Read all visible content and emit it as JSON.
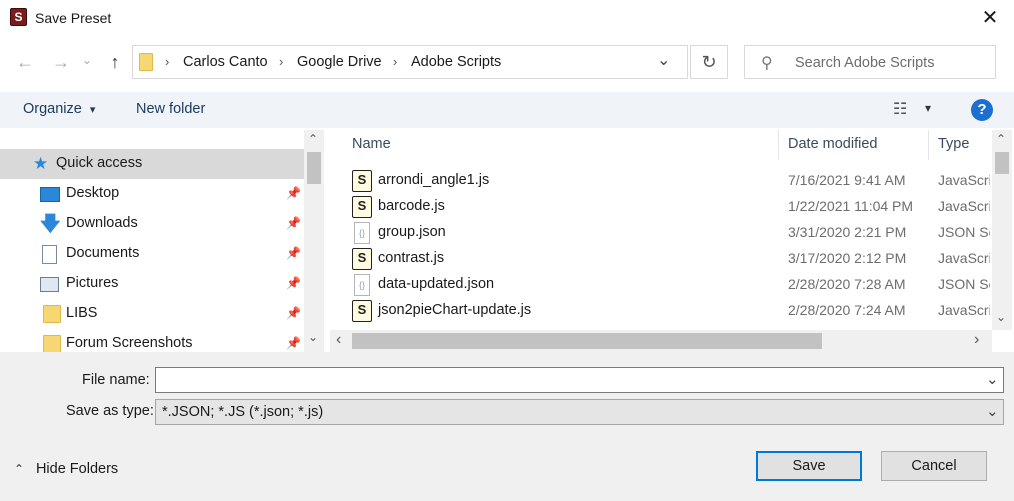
{
  "window": {
    "title": "Save Preset",
    "app_icon": "S",
    "close_glyph": "✕"
  },
  "address": {
    "back_glyph": "←",
    "forward_glyph": "→",
    "recent_glyph": "⌄",
    "up_glyph": "↑",
    "crumbs": [
      "Carlos Canto",
      "Google Drive",
      "Adobe Scripts"
    ],
    "separator": "›",
    "dropdown_glyph": "⌄",
    "refresh_glyph": "↻",
    "search_icon_glyph": "⚲",
    "search_placeholder": "Search Adobe Scripts"
  },
  "toolbar": {
    "organize": "Organize",
    "organize_caret": "▾",
    "new_folder": "New folder",
    "view_glyph": "☷",
    "view_caret": "▾",
    "help": "?"
  },
  "nav": {
    "items": [
      {
        "label": "Quick access",
        "icon": "star-icon"
      },
      {
        "label": "Desktop",
        "icon": "desktop-icon"
      },
      {
        "label": "Downloads",
        "icon": "download-arrow-icon"
      },
      {
        "label": "Documents",
        "icon": "document-icon"
      },
      {
        "label": "Pictures",
        "icon": "picture-icon"
      },
      {
        "label": "LIBS",
        "icon": "folder-icon"
      },
      {
        "label": "Forum Screenshots",
        "icon": "folder-icon"
      }
    ],
    "pin_glyph": "📌",
    "scroll_up": "⌃",
    "scroll_down": "⌄"
  },
  "files": {
    "columns": {
      "name": "Name",
      "date": "Date modified",
      "type": "Type"
    },
    "sort_glyph": "⌃",
    "rows": [
      {
        "name": "arrondi_angle1.js",
        "date": "7/16/2021 9:41 AM",
        "type": "JavaScri",
        "icon": "js-script-icon"
      },
      {
        "name": "barcode.js",
        "date": "1/22/2021 11:04 PM",
        "type": "JavaScri",
        "icon": "js-script-icon"
      },
      {
        "name": "group.json",
        "date": "3/31/2020 2:21 PM",
        "type": "JSON Sc",
        "icon": "json-file-icon"
      },
      {
        "name": "contrast.js",
        "date": "3/17/2020 2:12 PM",
        "type": "JavaScri",
        "icon": "js-script-icon"
      },
      {
        "name": "data-updated.json",
        "date": "2/28/2020 7:28 AM",
        "type": "JSON Sc",
        "icon": "json-file-icon"
      },
      {
        "name": "json2pieChart-update.js",
        "date": "2/28/2020 7:24 AM",
        "type": "JavaScri",
        "icon": "js-script-icon"
      }
    ],
    "scroll_left": "‹",
    "scroll_right": "›"
  },
  "form": {
    "file_name_label": "File name:",
    "file_name_value": "",
    "save_as_type_label": "Save as type:",
    "save_as_type_value": "*.JSON; *.JS (*.json; *.js)",
    "hide_folders": "Hide Folders",
    "hide_caret": "⌃",
    "save": "Save",
    "cancel": "Cancel"
  },
  "colors": {
    "accent": "#0078d7",
    "help_blue": "#1a6fd0",
    "toolbar_bg": "#f0f4f9",
    "selected_bg": "#d9d9d9",
    "folder_yellow": "#f7d774"
  }
}
